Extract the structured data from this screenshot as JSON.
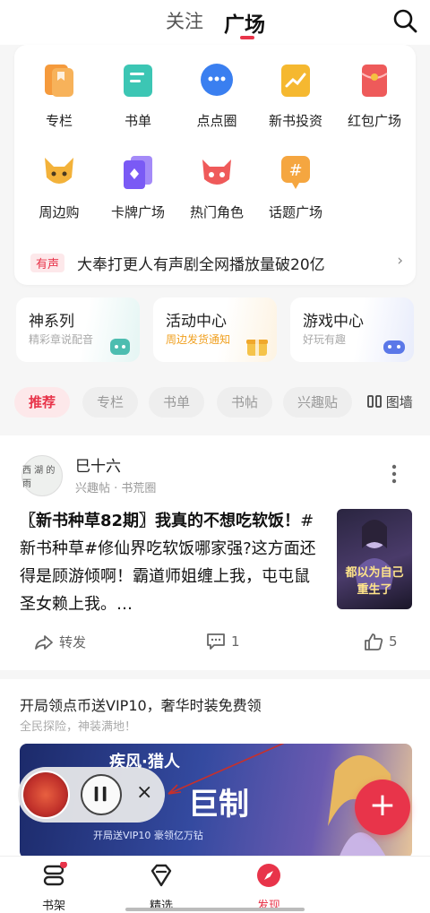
{
  "header": {
    "tabs": [
      "关注",
      "广场"
    ],
    "active_tab": "广场"
  },
  "grid": [
    {
      "label": "专栏",
      "icon": "book-column-icon",
      "color": "#f59a3c"
    },
    {
      "label": "书单",
      "icon": "booklist-icon",
      "color": "#3cc6b4"
    },
    {
      "label": "点点圈",
      "icon": "chat-circle-icon",
      "color": "#3a7ff0"
    },
    {
      "label": "新书投资",
      "icon": "trend-chart-icon",
      "color": "#f5b830"
    },
    {
      "label": "红包广场",
      "icon": "red-envelope-icon",
      "color": "#ee5a5a"
    },
    {
      "label": "周边购",
      "icon": "fox-mascot-icon",
      "color": "#f3b23a"
    },
    {
      "label": "卡牌广场",
      "icon": "card-icon",
      "color": "#7a5af5"
    },
    {
      "label": "热门角色",
      "icon": "demon-mask-icon",
      "color": "#ef5a5a"
    },
    {
      "label": "话题广场",
      "icon": "hashtag-bubble-icon",
      "color": "#f5a640"
    }
  ],
  "notice": {
    "tag": "有声",
    "text": "大奉打更人有声剧全网播放量破20亿",
    "arrow": "›"
  },
  "features": [
    {
      "title": "神系列",
      "sub": "精彩章说配音"
    },
    {
      "title": "活动中心",
      "sub": "周边发货通知"
    },
    {
      "title": "游戏中心",
      "sub": "好玩有趣"
    }
  ],
  "chips": [
    "推荐",
    "专栏",
    "书单",
    "书帖",
    "兴趣贴"
  ],
  "grid_toggle": "图墙",
  "post": {
    "author": "巳十六",
    "meta": "兴趣帖 · 书荒圈",
    "avatar_text": "西 湖 的 雨",
    "title_hl": "〖新书种草82期〗我真的不想吃软饭！",
    "body": "#新书种草#修仙界吃软饭哪家强?这方面还得是顾游倾啊！霸道师姐缠上我，屯屯鼠圣女赖上我。…",
    "image_text": "都以为自己重生了",
    "share": "转发",
    "comments": "1",
    "likes": "5"
  },
  "promo": {
    "title": "开局领点币送VIP10，奢华时装免费领",
    "sub": "全民探险，神装满地！",
    "banner_title": "疾风·猎人",
    "banner_big": "巨制",
    "banner_sub": "开局送VIP10  豪领亿万钻"
  },
  "player": {
    "close": "×"
  },
  "fab": "+",
  "nav": [
    "书架",
    "精选",
    "发现"
  ],
  "colors": {
    "accent": "#e8344a"
  }
}
